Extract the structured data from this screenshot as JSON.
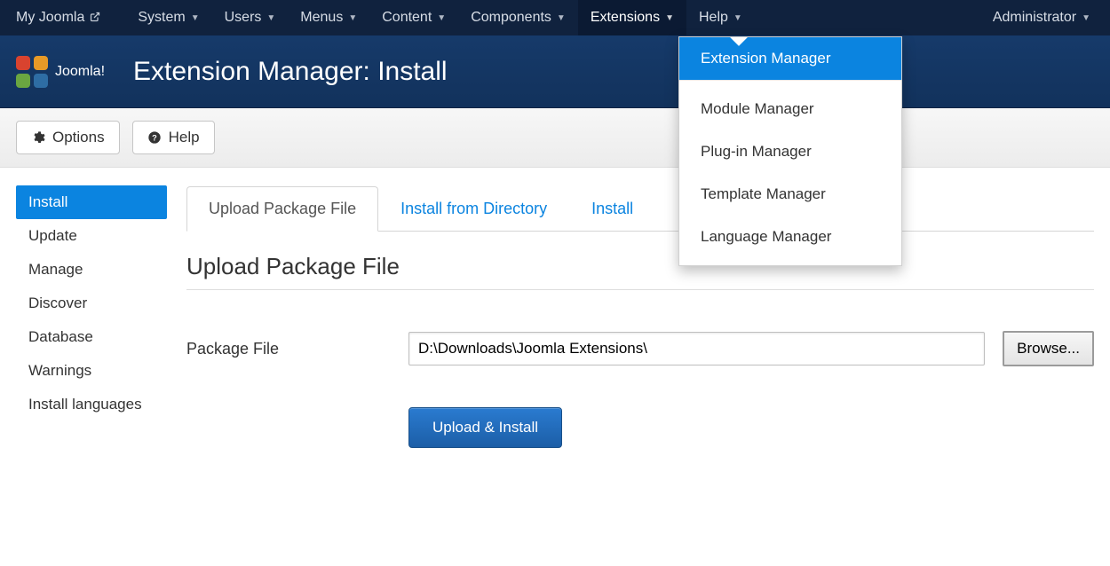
{
  "navbar": {
    "brand": "My Joomla",
    "items": [
      {
        "label": "System"
      },
      {
        "label": "Users"
      },
      {
        "label": "Menus"
      },
      {
        "label": "Content"
      },
      {
        "label": "Components"
      },
      {
        "label": "Extensions",
        "active": true
      },
      {
        "label": "Help"
      }
    ],
    "right": "Administrator"
  },
  "dropdown": {
    "items": [
      {
        "label": "Extension Manager",
        "highlight": true
      },
      {
        "label": "Module Manager"
      },
      {
        "label": "Plug-in Manager"
      },
      {
        "label": "Template Manager"
      },
      {
        "label": "Language Manager"
      }
    ]
  },
  "header": {
    "brand": "Joomla!",
    "title": "Extension Manager: Install"
  },
  "toolbar": {
    "options": "Options",
    "help": "Help"
  },
  "sidebar": {
    "items": [
      {
        "label": "Install",
        "active": true
      },
      {
        "label": "Update"
      },
      {
        "label": "Manage"
      },
      {
        "label": "Discover"
      },
      {
        "label": "Database"
      },
      {
        "label": "Warnings"
      },
      {
        "label": "Install languages"
      }
    ]
  },
  "tabs": {
    "items": [
      {
        "label": "Upload Package File",
        "active": true
      },
      {
        "label": "Install from Directory"
      },
      {
        "label": "Install"
      }
    ]
  },
  "panel": {
    "heading": "Upload Package File",
    "field_label": "Package File",
    "field_value": "D:\\Downloads\\Joomla Extensions\\",
    "browse_label": "Browse...",
    "submit_label": "Upload & Install"
  }
}
